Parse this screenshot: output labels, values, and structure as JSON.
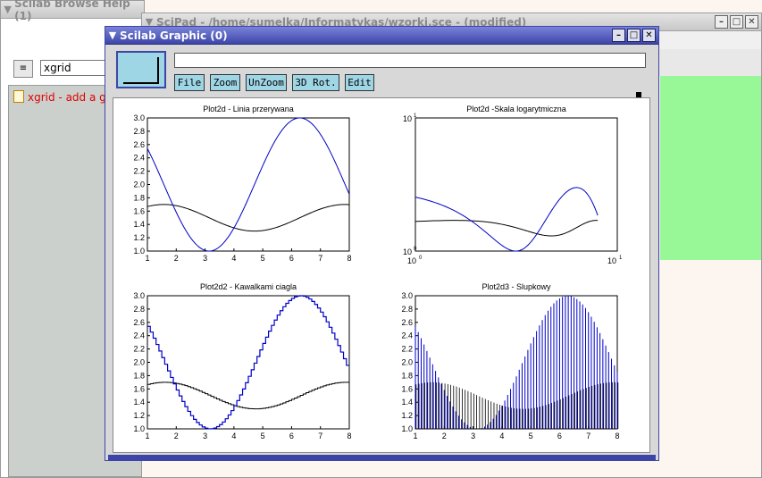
{
  "help": {
    "title": "Scilab Browse Help (1)",
    "search_value": "xgrid",
    "result": "xgrid - add a g"
  },
  "scipad": {
    "title": "SciPad - /home/sumelka/Informatykas/wzorki.sce - (modified)"
  },
  "graphic": {
    "title": "Scilab Graphic (0)",
    "buttons": {
      "file": "File",
      "zoom": "Zoom",
      "unzoom": "UnZoom",
      "rot": "3D Rot.",
      "edit": "Edit"
    }
  },
  "chart_data": [
    {
      "type": "line",
      "title": "Plot2d - Linia przerywana",
      "xlim": [
        1,
        8
      ],
      "ylim": [
        1.0,
        3.0
      ],
      "xticks": [
        "1",
        "2",
        "3",
        "4",
        "5",
        "6",
        "7",
        "8"
      ],
      "yticks": [
        "1.0",
        "1.2",
        "1.4",
        "1.6",
        "1.8",
        "2.0",
        "2.2",
        "2.4",
        "2.6",
        "2.8",
        "3.0"
      ],
      "style": "line"
    },
    {
      "type": "line",
      "title": "Plot2d -Skala logarytmiczna",
      "xscale": "log",
      "yscale": "log",
      "xticks": [
        "10",
        "10"
      ],
      "xtick_exp": [
        "0",
        "1"
      ],
      "yticks": [
        "10",
        "10"
      ],
      "ytick_exp": [
        "0",
        "1"
      ],
      "style": "line"
    },
    {
      "type": "line",
      "title": "Plot2d2 - Kawalkami ciagla",
      "xlim": [
        1,
        8
      ],
      "ylim": [
        1.0,
        3.0
      ],
      "xticks": [
        "1",
        "2",
        "3",
        "4",
        "5",
        "6",
        "7",
        "8"
      ],
      "yticks": [
        "1.0",
        "1.2",
        "1.4",
        "1.6",
        "1.8",
        "2.0",
        "2.2",
        "2.4",
        "2.6",
        "2.8",
        "3.0"
      ],
      "style": "step"
    },
    {
      "type": "bar",
      "title": "Plot2d3 - Slupkowy",
      "xlim": [
        1,
        8
      ],
      "ylim": [
        1.0,
        3.0
      ],
      "xticks": [
        "1",
        "2",
        "3",
        "4",
        "5",
        "6",
        "7",
        "8"
      ],
      "yticks": [
        "1.0",
        "1.2",
        "1.4",
        "1.6",
        "1.8",
        "2.0",
        "2.2",
        "2.4",
        "2.6",
        "2.8",
        "3.0"
      ],
      "style": "bars"
    }
  ],
  "colors": {
    "series_blue": "#0000c8",
    "series_black": "#000000",
    "title_active": "#3d46a8",
    "button_bg": "#9fd6e6"
  }
}
